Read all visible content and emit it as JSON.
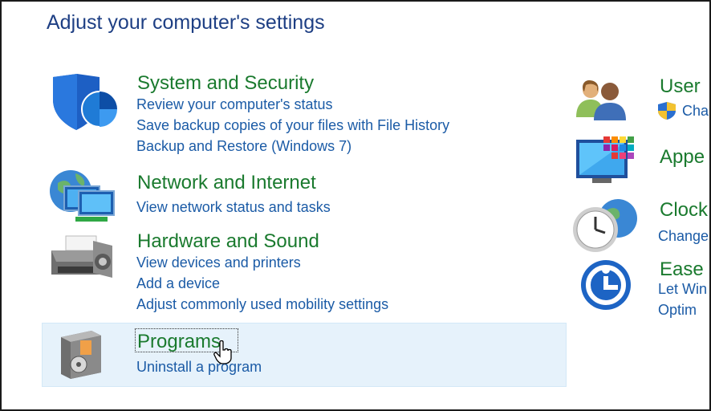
{
  "page": {
    "title": "Adjust your computer's settings"
  },
  "categories": [
    {
      "title": "System and Security",
      "icon": "shield-icon",
      "links": [
        "Review your computer's status",
        "Save backup copies of your files with File History",
        "Backup and Restore (Windows 7)"
      ]
    },
    {
      "title": "Network and Internet",
      "icon": "network-icon",
      "links": [
        "View network status and tasks"
      ]
    },
    {
      "title": "Hardware and Sound",
      "icon": "printer-icon",
      "links": [
        "View devices and printers",
        "Add a device",
        "Adjust commonly used mobility settings"
      ]
    },
    {
      "title": "Programs",
      "icon": "programs-icon",
      "links": [
        "Uninstall a program"
      ]
    }
  ],
  "right_categories": [
    {
      "title": "User",
      "icon": "users-icon",
      "links": [
        "Cha"
      ]
    },
    {
      "title": "Appe",
      "icon": "appearance-icon",
      "links": []
    },
    {
      "title": "Clock",
      "icon": "clock-icon",
      "links": [
        "Change"
      ]
    },
    {
      "title": "Ease",
      "icon": "ease-of-access-icon",
      "links": [
        "Let Win",
        "Optim"
      ]
    }
  ],
  "colors": {
    "title_blue": "#1e3f84",
    "category_green": "#1a7a2e",
    "link_blue": "#1b5ba6",
    "hover_background": "#e6f2fb"
  }
}
